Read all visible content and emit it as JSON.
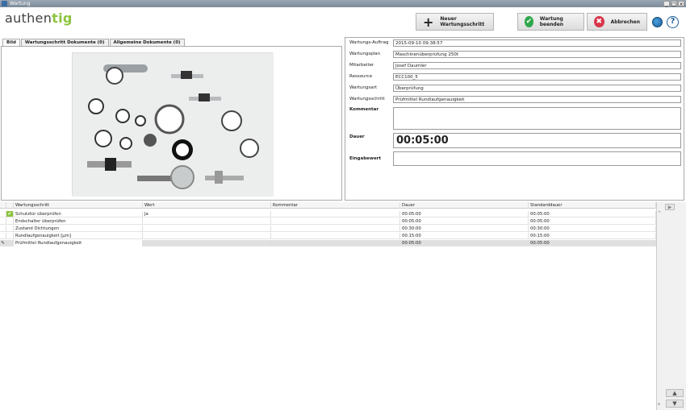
{
  "window": {
    "title": "Wartung",
    "min": "_",
    "max": "□",
    "close": "×"
  },
  "logo": {
    "prefix": "authen",
    "suffix": "tig"
  },
  "toolbar": {
    "new_step": "Neuer Wartungsschritt",
    "finish": "Wartung beenden",
    "cancel": "Abbrechen",
    "help": "?"
  },
  "tabs": [
    "Bild",
    "Wartungsschritt Dokumente (0)",
    "Allgemeine Dokumente (0)"
  ],
  "form": {
    "auftrag_label": "Wartungs-Auftrag",
    "auftrag": "2015-09-10 09:38:57",
    "plan_label": "Wartungsplan",
    "plan": "Maschinenüberprüfung 250t",
    "mitarbeiter_label": "Mitarbeiter",
    "mitarbeiter": "Josef Daumler",
    "ressource_label": "Ressource",
    "ressource": "ECC100_5",
    "art_label": "Wartungsart",
    "art": "Überprüfung",
    "schritt_label": "Wartungsschritt",
    "schritt": "Prüfmittel Rundlaufgenauigkeit",
    "kommentar_label": "Kommentar",
    "dauer_label": "Dauer",
    "dauer": "00:05:00",
    "eingabe_label": "Eingabewert"
  },
  "grid": {
    "headers": [
      "Wartungsschritt",
      "Wert",
      "Kommentar",
      "Dauer",
      "Standarddauer"
    ],
    "rows": [
      {
        "name": "Schutztür überprüfen",
        "wert": "Ja",
        "kommentar": "",
        "dauer": "00:05:00",
        "std": "00:05:00"
      },
      {
        "name": "Endschalter überprüfen",
        "wert": "",
        "kommentar": "",
        "dauer": "00:05:00",
        "std": "00:05:00"
      },
      {
        "name": "Zustand Dichtungen",
        "wert": "",
        "kommentar": "",
        "dauer": "00:30:00",
        "std": "00:30:00"
      },
      {
        "name": "Rundlaufgenauigkeit [µm]",
        "wert": "",
        "kommentar": "",
        "dauer": "00:15:00",
        "std": "00:15:00"
      },
      {
        "name": "Prüfmittel Rundlaufgenauigkeit",
        "wert": "",
        "kommentar": "",
        "dauer": "00:05:00",
        "std": "00:05:00"
      }
    ]
  },
  "side": {
    "play": "▶",
    "up": "▲",
    "down": "▼",
    "scroll_up": "^",
    "scroll_down": "v"
  },
  "colors": {
    "accent_green": "#8cc43e",
    "finish_green": "#2ea84b",
    "cancel_red": "#d9364a"
  }
}
